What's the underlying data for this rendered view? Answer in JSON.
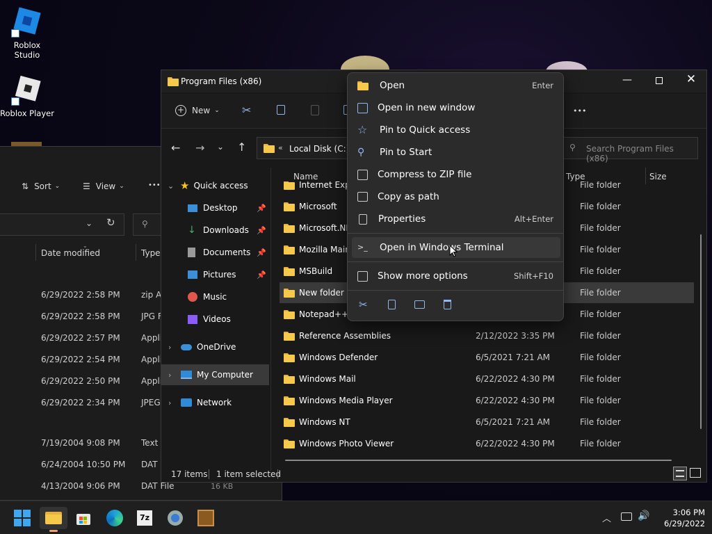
{
  "desktop": {
    "icons": [
      {
        "label": "Roblox Studio"
      },
      {
        "label": "Roblox Player"
      }
    ]
  },
  "bg_window": {
    "toolbar": {
      "sort": "Sort",
      "view": "View",
      "more": "•••"
    },
    "columns": [
      "Date modified",
      "Type"
    ],
    "rows": [
      {
        "date": "6/29/2022 2:58 PM",
        "type": "zip Ar"
      },
      {
        "date": "6/29/2022 2:58 PM",
        "type": "JPG Fi"
      },
      {
        "date": "6/29/2022 2:57 PM",
        "type": "Applic"
      },
      {
        "date": "6/29/2022 2:54 PM",
        "type": "Applic"
      },
      {
        "date": "6/29/2022 2:50 PM",
        "type": "Applic"
      },
      {
        "date": "6/29/2022 2:34 PM",
        "type": "JPEG I"
      },
      {
        "date": "7/19/2004 9:08 PM",
        "type": "Text D"
      },
      {
        "date": "6/24/2004 10:50 PM",
        "type": "DAT Fi"
      },
      {
        "date": "4/13/2004 9:06 PM",
        "type": "DAT File",
        "size": "16 KB"
      }
    ]
  },
  "window": {
    "title": "Program Files (x86)",
    "new_label": "New",
    "more": "•••",
    "address": {
      "root": "Local Disk (C:)"
    },
    "search_placeholder": "Search Program Files (x86)",
    "columns": {
      "name": "Name",
      "type": "Type",
      "size": "Size"
    },
    "nav": {
      "quick_access": "Quick access",
      "items": [
        {
          "label": "Desktop",
          "pinned": true,
          "color": "#3b8fd8"
        },
        {
          "label": "Downloads",
          "pinned": true,
          "color": "#3fae6a"
        },
        {
          "label": "Documents",
          "pinned": true,
          "color": "#8a8a8a"
        },
        {
          "label": "Pictures",
          "pinned": true,
          "color": "#3b8fd8"
        },
        {
          "label": "Music",
          "pinned": false,
          "color": "#e0584c"
        },
        {
          "label": "Videos",
          "pinned": false,
          "color": "#8b5cf6"
        }
      ],
      "onedrive": "OneDrive",
      "my_computer": "My Computer",
      "network": "Network"
    },
    "files": [
      {
        "name": "Internet Explo",
        "date": "",
        "type": "File folder"
      },
      {
        "name": "Microsoft",
        "date": "",
        "type": "File folder"
      },
      {
        "name": "Microsoft.NE",
        "date": "",
        "type": "File folder"
      },
      {
        "name": "Mozilla Maint",
        "date": "",
        "type": "File folder"
      },
      {
        "name": "MSBuild",
        "date": "",
        "type": "File folder"
      },
      {
        "name": "New folder",
        "date": "",
        "type": "File folder",
        "selected": true
      },
      {
        "name": "Notepad++",
        "date": "",
        "type": "File folder"
      },
      {
        "name": "Reference Assemblies",
        "date": "2/12/2022 3:35 PM",
        "type": "File folder"
      },
      {
        "name": "Windows Defender",
        "date": "6/5/2021 7:21 AM",
        "type": "File folder"
      },
      {
        "name": "Windows Mail",
        "date": "6/22/2022 4:30 PM",
        "type": "File folder"
      },
      {
        "name": "Windows Media Player",
        "date": "6/22/2022 4:30 PM",
        "type": "File folder"
      },
      {
        "name": "Windows NT",
        "date": "6/5/2021 7:21 AM",
        "type": "File folder"
      },
      {
        "name": "Windows Photo Viewer",
        "date": "6/22/2022 4:30 PM",
        "type": "File folder"
      }
    ],
    "status": {
      "items": "17 items",
      "selected": "1 item selected"
    }
  },
  "context_menu": {
    "items": [
      {
        "label": "Open",
        "shortcut": "Enter",
        "icon": "open-folder-icon"
      },
      {
        "label": "Open in new window",
        "shortcut": "",
        "icon": "new-window-icon"
      },
      {
        "label": "Pin to Quick access",
        "shortcut": "",
        "icon": "star-icon"
      },
      {
        "label": "Pin to Start",
        "shortcut": "",
        "icon": "pin-icon"
      },
      {
        "label": "Compress to ZIP file",
        "shortcut": "",
        "icon": "zip-icon"
      },
      {
        "label": "Copy as path",
        "shortcut": "",
        "icon": "copy-path-icon"
      },
      {
        "label": "Properties",
        "shortcut": "Alt+Enter",
        "icon": "properties-icon"
      },
      {
        "label": "Open in Windows Terminal",
        "shortcut": "",
        "icon": "terminal-icon"
      },
      {
        "label": "Show more options",
        "shortcut": "Shift+F10",
        "icon": "more-options-icon"
      }
    ]
  },
  "taskbar": {
    "time": "3:06 PM",
    "date": "6/29/2022"
  }
}
